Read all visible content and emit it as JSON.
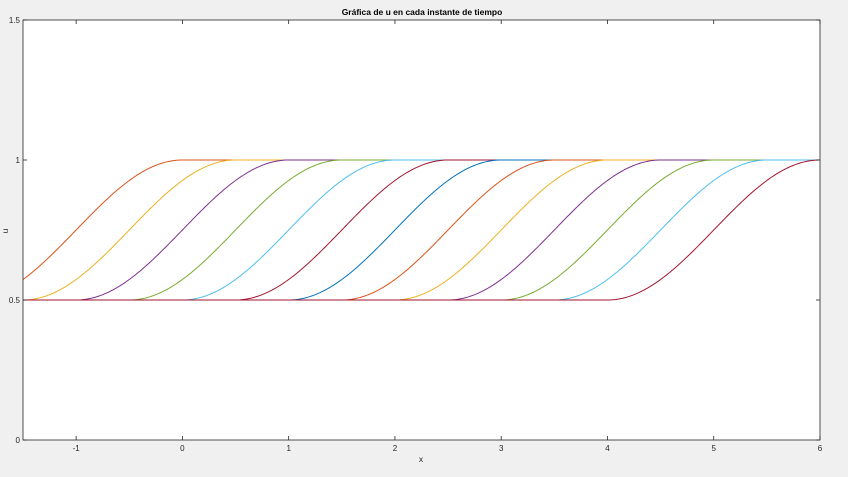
{
  "chart_data": {
    "type": "line",
    "title": "Gráfica de u en cada instante de tiempo",
    "xlabel": "x",
    "ylabel": "u",
    "xlim": [
      -1.5,
      6
    ],
    "ylim": [
      0,
      1.5
    ],
    "grid": false,
    "legend": "none",
    "x_ticks": [
      -1,
      0,
      1,
      2,
      3,
      4,
      5,
      6
    ],
    "y_ticks": [
      0,
      0.5,
      1,
      1.5
    ],
    "x_tick_labels": [
      "-1",
      "0",
      "1",
      "2",
      "3",
      "4",
      "5",
      "6"
    ],
    "y_tick_labels": [
      "0",
      "0.5",
      "1",
      "1.5"
    ],
    "curve_shape": "smooth cosine step from 0.5 to 1 over a width of 2 in x",
    "series": [
      {
        "ramp_start": -2.0,
        "ramp_end": 0.0,
        "color": "#d95319"
      },
      {
        "ramp_start": -1.5,
        "ramp_end": 0.5,
        "color": "#edb120"
      },
      {
        "ramp_start": -1.0,
        "ramp_end": 1.0,
        "color": "#7e2f8e"
      },
      {
        "ramp_start": -0.5,
        "ramp_end": 1.5,
        "color": "#77ac30"
      },
      {
        "ramp_start": 0.0,
        "ramp_end": 2.0,
        "color": "#4dbeee"
      },
      {
        "ramp_start": 0.5,
        "ramp_end": 2.5,
        "color": "#a2142f"
      },
      {
        "ramp_start": 1.0,
        "ramp_end": 3.0,
        "color": "#0072bd"
      },
      {
        "ramp_start": 1.5,
        "ramp_end": 3.5,
        "color": "#d95319"
      },
      {
        "ramp_start": 2.0,
        "ramp_end": 4.0,
        "color": "#edb120"
      },
      {
        "ramp_start": 2.5,
        "ramp_end": 4.5,
        "color": "#7e2f8e"
      },
      {
        "ramp_start": 3.0,
        "ramp_end": 5.0,
        "color": "#77ac30"
      },
      {
        "ramp_start": 3.5,
        "ramp_end": 5.5,
        "color": "#4dbeee"
      },
      {
        "ramp_start": 4.0,
        "ramp_end": 6.0,
        "color": "#a2142f"
      }
    ]
  }
}
